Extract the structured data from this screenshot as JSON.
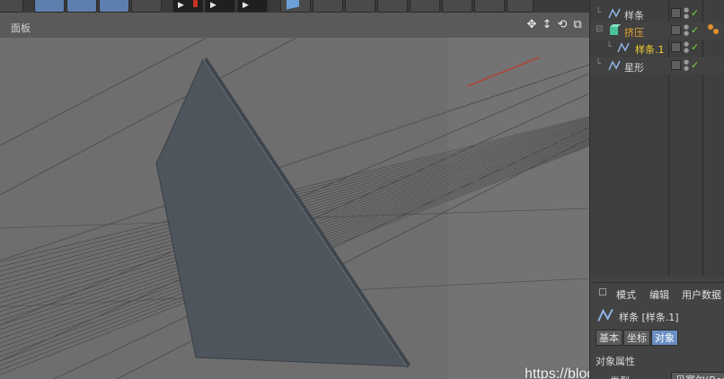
{
  "viewport": {
    "title": "面板",
    "nav_icons": [
      "move-icon",
      "dolly-icon",
      "rotate-icon",
      "maximize-icon"
    ],
    "nav_glyphs": [
      "✥",
      "↕",
      "⟲",
      "⧉"
    ]
  },
  "toolbar": {
    "play_glyph": "▶"
  },
  "object_manager": {
    "items": [
      {
        "label": "样条",
        "icon": "spline-icon",
        "color": "#d6d6d6"
      },
      {
        "label": "挤压",
        "icon": "extrude-icon",
        "color": "#e6a230"
      },
      {
        "label": "样条.1",
        "icon": "spline-icon",
        "color": "#f2d230"
      },
      {
        "label": "星形",
        "icon": "spline-icon",
        "color": "#d6d6d6"
      }
    ],
    "check_glyph": "✓"
  },
  "attributes": {
    "menu": [
      "模式",
      "编辑",
      "用户数据"
    ],
    "object_label": "样条 [样条.1]",
    "tabs": [
      "基本",
      "坐标",
      "对象"
    ],
    "active_tab": "对象",
    "section": "对象属性",
    "type_label": "类型",
    "type_value": "贝塞尔(Bezier)"
  },
  "watermark": "https://blog.csdn.net/lidashent",
  "colors": {
    "shape_fill": "#4e555d",
    "viewport_bg": "#6e6e6e",
    "selection_blue": "#6a8fc4",
    "axis_red": "#c8321e"
  }
}
